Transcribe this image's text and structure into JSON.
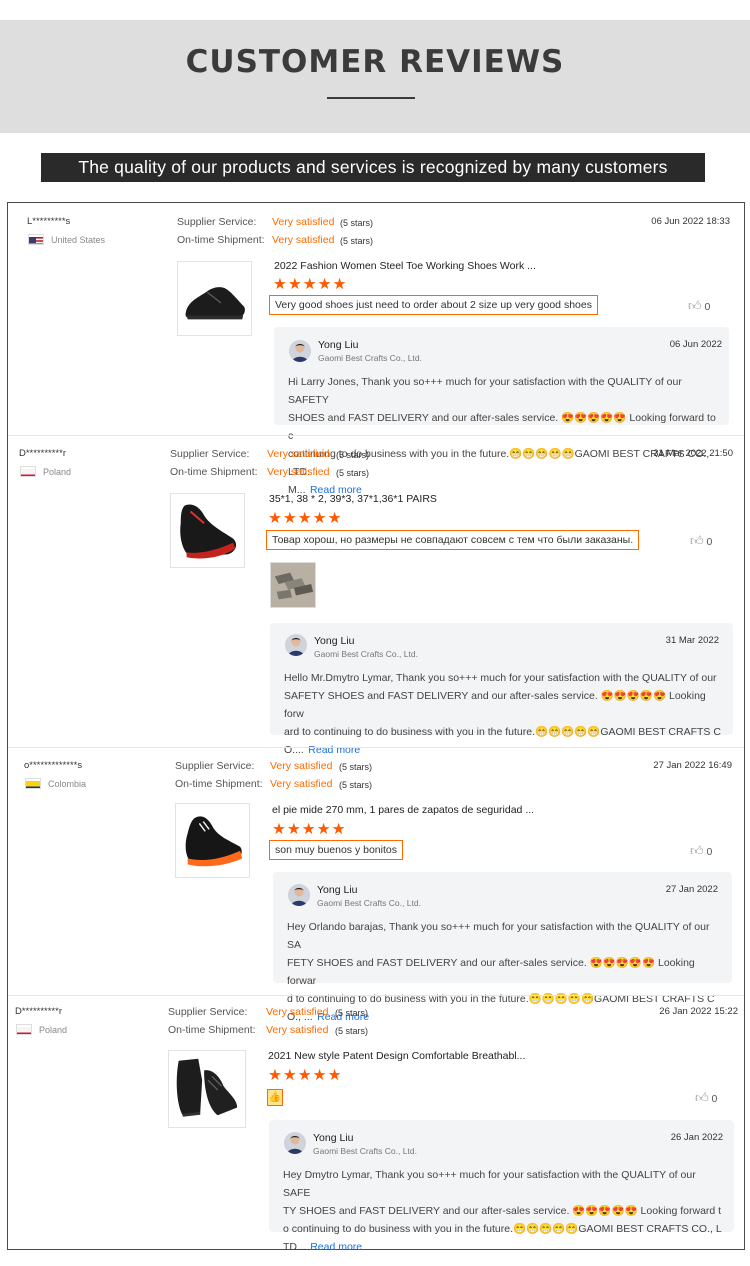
{
  "header": {
    "title": "CUSTOMER REVIEWS",
    "subtitle": "The quality of our products and services is recognized by many customers"
  },
  "labels": {
    "supplier_service": "Supplier Service:",
    "ontime_shipment": "On-time Shipment:",
    "read_more": "Read more"
  },
  "reviews": [
    {
      "user": "L*********s",
      "country": "United States",
      "flag": "us",
      "supplier_rating": "Very satisfied",
      "supplier_stars": "(5 stars)",
      "shipment_rating": "Very satisfied",
      "shipment_stars": "(5 stars)",
      "date": "06 Jun 2022 18:33",
      "product_title": "2022 Fashion Women Steel Toe Working Shoes Work ...",
      "stars": "★★★★★",
      "text": "Very good shoes just need to order about 2 size up very good shoes",
      "likes": "0",
      "reply": {
        "name": "Yong Liu",
        "company": "Gaomi Best Crafts Co., Ltd.",
        "date": "06 Jun 2022",
        "text": "Hi Larry Jones, Thank you so+++ much for your satisfaction with the QUALITY of our SAFETY\nSHOES and FAST DELIVERY and our after-sales service. 😍😍😍😍😍 Looking forward to c\ncontinuing to do business with you in the future.😁😁😁😁😁GAOMI BEST CRAFTS CO., LTD.\nM..."
      }
    },
    {
      "user": "D**********r",
      "country": "Poland",
      "flag": "pl",
      "supplier_rating": "Very satisfied",
      "supplier_stars": "(5 stars)",
      "shipment_rating": "Very satisfied",
      "shipment_stars": "(5 stars)",
      "date": "31 Mar 2022 21:50",
      "product_title": "35*1, 38 * 2, 39*3, 37*1,36*1 PAIRS",
      "stars": "★★★★★",
      "text": "Товар хорош, но размеры не совпадают совсем с тем что были заказаны.",
      "likes": "0",
      "reply": {
        "name": "Yong Liu",
        "company": "Gaomi Best Crafts Co., Ltd.",
        "date": "31 Mar 2022",
        "text": "Hello Mr.Dmytro Lymar, Thank you so+++ much for your satisfaction with the QUALITY of our\nSAFETY SHOES and FAST DELIVERY and our after-sales service. 😍😍😍😍😍 Looking forw\nard to continuing to do business with you in the future.😁😁😁😁😁GAOMI BEST CRAFTS C\nO...."
      }
    },
    {
      "user": "o*************s",
      "country": "Colombia",
      "flag": "co",
      "supplier_rating": "Very satisfied",
      "supplier_stars": "(5 stars)",
      "shipment_rating": "Very satisfied",
      "shipment_stars": "(5 stars)",
      "date": "27 Jan 2022 16:49",
      "product_title": "el pie mide 270 mm, 1 pares de zapatos de seguridad ...",
      "stars": "★★★★★",
      "text": "son muy buenos y bonitos",
      "likes": "0",
      "reply": {
        "name": "Yong Liu",
        "company": "Gaomi Best Crafts Co., Ltd.",
        "date": "27 Jan 2022",
        "text": "Hey Orlando barajas, Thank you so+++ much for your satisfaction with the QUALITY of our SA\nFETY SHOES and FAST DELIVERY and our after-sales service. 😍😍😍😍😍 Looking forwar\nd to continuing to do business with you in the future.😁😁😁😁😁GAOMI BEST CRAFTS C\nO., ..."
      }
    },
    {
      "user": "D**********r",
      "country": "Poland",
      "flag": "pl",
      "supplier_rating": "Very satisfied",
      "supplier_stars": "(5 stars)",
      "shipment_rating": "Very satisfied",
      "shipment_stars": "(5 stars)",
      "date": "26 Jan 2022 15:22",
      "product_title": "2021 New style Patent Design Comfortable Breathabl...",
      "stars": "★★★★★",
      "text": "👍",
      "likes": "0",
      "reply": {
        "name": "Yong Liu",
        "company": "Gaomi Best Crafts Co., Ltd.",
        "date": "26 Jan 2022",
        "text": "Hey Dmytro Lymar, Thank you so+++ much for your satisfaction with the QUALITY of our SAFE\nTY SHOES and FAST DELIVERY and our after-sales service. 😍😍😍😍😍 Looking forward t\no continuing to do business with you in the future.😁😁😁😁😁GAOMI BEST CRAFTS CO., L\nTD..."
      }
    }
  ]
}
